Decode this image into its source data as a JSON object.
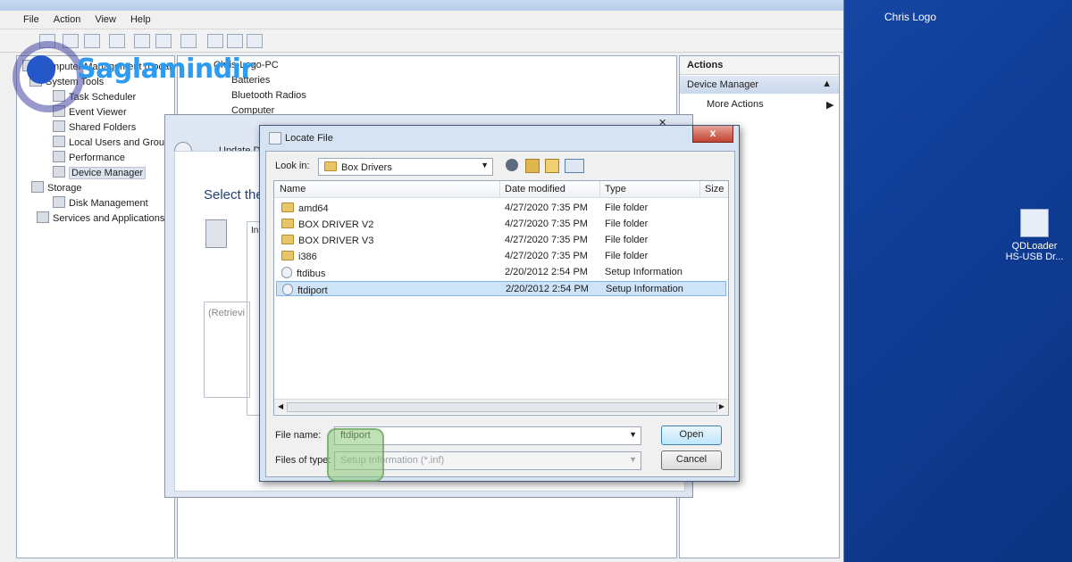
{
  "desktop": {
    "user_label": "Chris Logo",
    "icon_label_line1": "QDLoader",
    "icon_label_line2": "HS-USB Dr..."
  },
  "computer_management": {
    "menu": [
      "File",
      "Action",
      "View",
      "Help"
    ],
    "tree": [
      {
        "label": "Computer Management (Local)",
        "indent": 0
      },
      {
        "label": "System Tools",
        "indent": 1
      },
      {
        "label": "Task Scheduler",
        "indent": 2
      },
      {
        "label": "Event Viewer",
        "indent": 2
      },
      {
        "label": "Shared Folders",
        "indent": 2
      },
      {
        "label": "Local Users and Groups",
        "indent": 2
      },
      {
        "label": "Performance",
        "indent": 2
      },
      {
        "label": "Device Manager",
        "indent": 2
      },
      {
        "label": "Storage",
        "indent": 1
      },
      {
        "label": "Disk Management",
        "indent": 2
      },
      {
        "label": "Services and Applications",
        "indent": 1
      }
    ],
    "center_rows": [
      "Chris-Logo-PC",
      "Batteries",
      "Bluetooth Radios",
      "Computer"
    ],
    "actions": {
      "header": "Actions",
      "section": "Device Manager",
      "more": "More Actions"
    }
  },
  "update_driver": {
    "title": "Update Driver Software",
    "heading": "Select the",
    "retrieving": "(Retrievi",
    "inner_label": "In"
  },
  "locate_file": {
    "title": "Locate File",
    "close_glyph": "x",
    "look_in_label": "Look in:",
    "look_in_value": "Box Drivers",
    "columns": [
      "Name",
      "Date modified",
      "Type",
      "Size"
    ],
    "rows": [
      {
        "name": "amd64",
        "date": "4/27/2020 7:35 PM",
        "type": "File folder",
        "kind": "folder"
      },
      {
        "name": "BOX DRIVER V2",
        "date": "4/27/2020 7:35 PM",
        "type": "File folder",
        "kind": "folder"
      },
      {
        "name": "BOX DRIVER V3",
        "date": "4/27/2020 7:35 PM",
        "type": "File folder",
        "kind": "folder"
      },
      {
        "name": "i386",
        "date": "4/27/2020 7:35 PM",
        "type": "File folder",
        "kind": "folder"
      },
      {
        "name": "ftdibus",
        "date": "2/20/2012 2:54 PM",
        "type": "Setup Information",
        "kind": "file"
      },
      {
        "name": "ftdiport",
        "date": "2/20/2012 2:54 PM",
        "type": "Setup Information",
        "kind": "file",
        "selected": true
      }
    ],
    "file_name_label": "File name:",
    "file_name_value": "ftdiport",
    "files_of_type_label": "Files of type:",
    "files_of_type_value": "Setup Information (*.inf)",
    "open_label": "Open",
    "cancel_label": "Cancel"
  },
  "watermark": {
    "text": "Saglamindir"
  },
  "colors": {
    "desktop": "#1a4fb0",
    "selection": "#cde3f8",
    "watermark": "#2d9cf0"
  }
}
